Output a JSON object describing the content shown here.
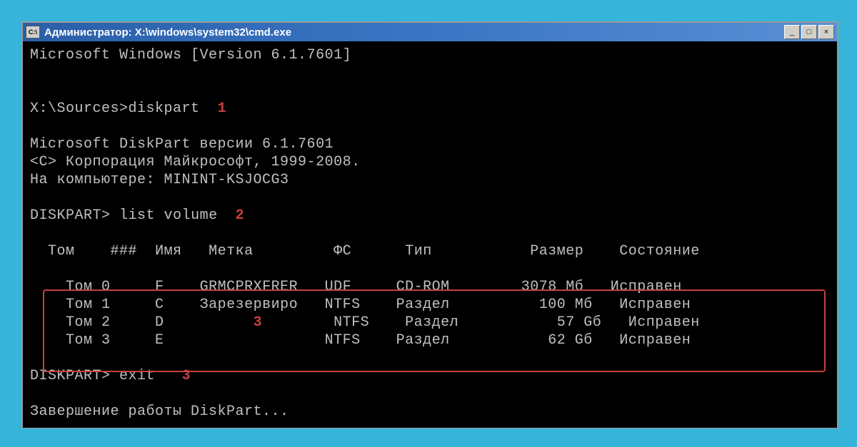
{
  "titlebar": {
    "icon_label": "C:\\",
    "title": "Администратор: X:\\windows\\system32\\cmd.exe"
  },
  "terminal": {
    "version_line": "Microsoft Windows [Version 6.1.7601]",
    "prompt1": "X:\\Sources>",
    "cmd1": "diskpart",
    "annot1": "1",
    "diskpart_version": "Microsoft DiskPart версии 6.1.7601",
    "copyright": "<C> Корпорация Майкрософт, 1999-2008.",
    "computer": "На компьютере: MININT-KSJOCG3",
    "prompt2": "DISKPART>",
    "cmd2": "list volume",
    "annot2": "2",
    "headers": {
      "tom": "Том",
      "num": "###",
      "name": "Имя",
      "label": "Метка",
      "fs": "ФС",
      "type": "Тип",
      "size": "Размер",
      "state": "Состояние"
    },
    "annot_table": "3",
    "rows": [
      {
        "tom": "Том 0",
        "name": "F",
        "label": "GRMCPRXFRER",
        "fs": "UDF",
        "type": "CD-ROM",
        "size": "3078 Мб",
        "state": "Исправен"
      },
      {
        "tom": "Том 1",
        "name": "C",
        "label": "Зарезервиро",
        "fs": "NTFS",
        "type": "Раздел",
        "size": " 100 Мб",
        "state": "Исправен"
      },
      {
        "tom": "Том 2",
        "name": "D",
        "label": "",
        "fs": "NTFS",
        "type": "Раздел",
        "size": "  57 Gб",
        "state": "Исправен"
      },
      {
        "tom": "Том 3",
        "name": "E",
        "label": "",
        "fs": "NTFS",
        "type": "Раздел",
        "size": "  62 Gб",
        "state": "Исправен"
      }
    ],
    "prompt3": "DISKPART>",
    "cmd3": "exit",
    "annot3": "3",
    "exit_msg": "Завершение работы DiskPart..."
  }
}
